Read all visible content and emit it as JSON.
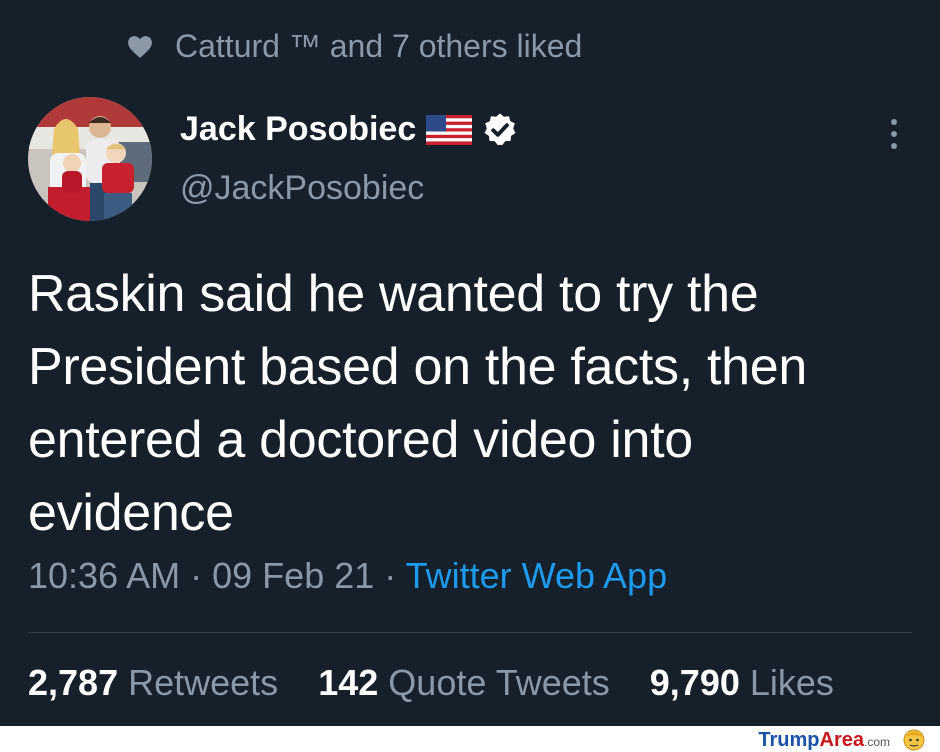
{
  "social_context": {
    "text": "Catturd ™ and 7 others liked",
    "icon": "heart-icon"
  },
  "author": {
    "name": "Jack Posobiec",
    "handle": "@JackPosobiec",
    "badges": [
      "us-flag-icon",
      "verified-icon"
    ]
  },
  "tweet": {
    "text": "Raskin said he wanted to try the President based on the facts, then entered a doctored video into evidence",
    "time": "10:36 AM",
    "date": "09 Feb 21",
    "separator": "·",
    "source": "Twitter Web App"
  },
  "stats": [
    {
      "count": "2,787",
      "label": "Retweets"
    },
    {
      "count": "142",
      "label": "Quote Tweets"
    },
    {
      "count": "9,790",
      "label": "Likes"
    }
  ],
  "watermark": {
    "part1": "Trump",
    "part2": "Area",
    "part3": ".com"
  },
  "colors": {
    "background": "#15202b",
    "secondary_text": "#8b98a5",
    "link": "#1d9bf0",
    "verified": "#ffffff"
  }
}
